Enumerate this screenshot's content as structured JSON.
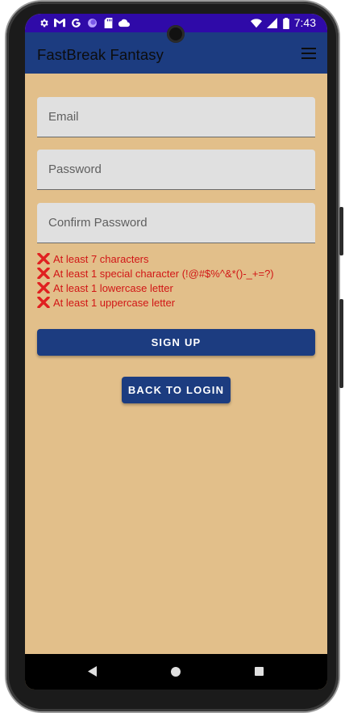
{
  "status_bar": {
    "time": "7:43",
    "left_icons": [
      "gear-icon",
      "gmail-icon",
      "google-icon",
      "circle-icon",
      "sd-card-icon",
      "cloud-icon"
    ],
    "right_icons": [
      "wifi-icon",
      "signal-icon",
      "battery-icon"
    ]
  },
  "app_bar": {
    "title": "FastBreak Fantasy",
    "menu_icon": "hamburger-menu-icon"
  },
  "form": {
    "email_placeholder": "Email",
    "password_placeholder": "Password",
    "confirm_placeholder": "Confirm Password"
  },
  "password_rules": [
    {
      "label": "At least 7 characters",
      "status": "failed"
    },
    {
      "label": "At least 1 special character (!@#$%^&*()-_+=?)",
      "status": "failed"
    },
    {
      "label": "At least 1 lowercase letter",
      "status": "failed"
    },
    {
      "label": "At least 1 uppercase letter",
      "status": "failed"
    }
  ],
  "buttons": {
    "sign_up": "SIGN UP",
    "back_to_login": "BACK TO LOGIN"
  },
  "nav_bar": {
    "back_icon": "back-triangle-icon",
    "home_icon": "home-circle-icon",
    "recents_icon": "recents-square-icon"
  },
  "colors": {
    "status_bar": "#2f0aa8",
    "app_bar": "#1c3c80",
    "background": "#e2bf8a",
    "field": "#e0e0e0",
    "error": "#d11616",
    "button": "#1c3c80"
  }
}
